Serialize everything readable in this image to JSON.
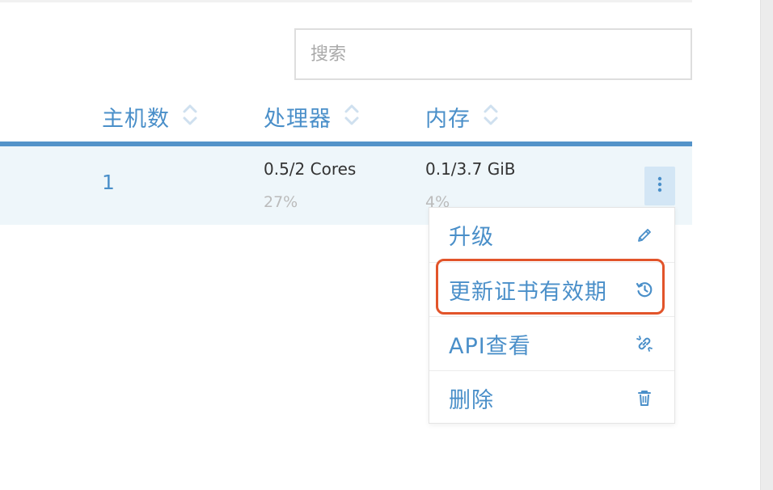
{
  "search": {
    "placeholder": "搜索"
  },
  "table": {
    "columns": [
      {
        "label": "主机数",
        "sort_icon": "sort-icon"
      },
      {
        "label": "处理器",
        "sort_icon": "sort-icon"
      },
      {
        "label": "内存",
        "sort_icon": "sort-icon"
      }
    ],
    "row": {
      "hosts": "1",
      "cpu": {
        "value": "0.5/2 Cores",
        "percent": "27%"
      },
      "memory": {
        "value": "0.1/3.7 GiB",
        "percent": "4%"
      }
    }
  },
  "actions_menu": {
    "trigger_icon": "more-vertical-icon",
    "items": [
      {
        "label": "升级",
        "icon": "pencil-icon"
      },
      {
        "label": "更新证书有效期",
        "icon": "history-icon",
        "highlighted": true
      },
      {
        "label": "API查看",
        "icon": "link-icon"
      },
      {
        "label": "删除",
        "icon": "trash-icon"
      }
    ]
  },
  "colors": {
    "accent": "#4a8fc9",
    "header_bar": "#5393c9",
    "row_background": "#eef6fa",
    "highlight_border": "#e2542a"
  }
}
